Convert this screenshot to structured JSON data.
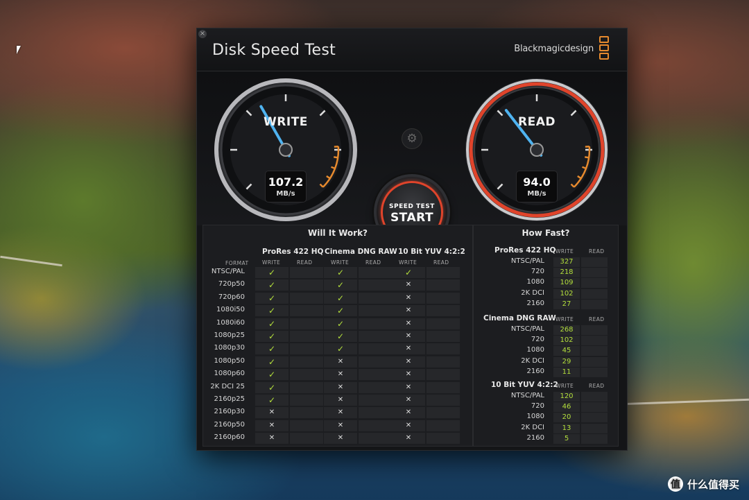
{
  "window": {
    "title": "Disk Speed Test",
    "brand": "Blackmagicdesign",
    "close_glyph": "×"
  },
  "gauges": {
    "write": {
      "label": "WRITE",
      "value": "107.2",
      "unit": "MB/s",
      "needle_level": 0.39
    },
    "read": {
      "label": "READ",
      "value": "94.0",
      "unit": "MB/s",
      "needle_level": 0.36
    }
  },
  "start_button": {
    "line1": "SPEED TEST",
    "line2": "START"
  },
  "settings_icon": "⚙",
  "will_it_work": {
    "title": "Will It Work?",
    "format_header": "FORMAT",
    "write_label": "WRITE",
    "read_label": "READ",
    "groups": [
      "ProRes 422 HQ",
      "Cinema DNG RAW",
      "10 Bit YUV 4:2:2"
    ],
    "rows": [
      {
        "format": "NTSC/PAL",
        "marks": [
          "ok",
          "",
          "ok",
          "",
          "ok",
          ""
        ]
      },
      {
        "format": "720p50",
        "marks": [
          "ok",
          "",
          "ok",
          "",
          "no",
          ""
        ]
      },
      {
        "format": "720p60",
        "marks": [
          "ok",
          "",
          "ok",
          "",
          "no",
          ""
        ]
      },
      {
        "format": "1080i50",
        "marks": [
          "ok",
          "",
          "ok",
          "",
          "no",
          ""
        ]
      },
      {
        "format": "1080i60",
        "marks": [
          "ok",
          "",
          "ok",
          "",
          "no",
          ""
        ]
      },
      {
        "format": "1080p25",
        "marks": [
          "ok",
          "",
          "ok",
          "",
          "no",
          ""
        ]
      },
      {
        "format": "1080p30",
        "marks": [
          "ok",
          "",
          "ok",
          "",
          "no",
          ""
        ]
      },
      {
        "format": "1080p50",
        "marks": [
          "ok",
          "",
          "no",
          "",
          "no",
          ""
        ]
      },
      {
        "format": "1080p60",
        "marks": [
          "ok",
          "",
          "no",
          "",
          "no",
          ""
        ]
      },
      {
        "format": "2K DCI 25",
        "marks": [
          "ok",
          "",
          "no",
          "",
          "no",
          ""
        ]
      },
      {
        "format": "2160p25",
        "marks": [
          "ok",
          "",
          "no",
          "",
          "no",
          ""
        ]
      },
      {
        "format": "2160p30",
        "marks": [
          "no",
          "",
          "no",
          "",
          "no",
          ""
        ]
      },
      {
        "format": "2160p50",
        "marks": [
          "no",
          "",
          "no",
          "",
          "no",
          ""
        ]
      },
      {
        "format": "2160p60",
        "marks": [
          "no",
          "",
          "no",
          "",
          "no",
          ""
        ]
      }
    ],
    "ok_glyph": "✓",
    "no_glyph": "✕"
  },
  "how_fast": {
    "title": "How Fast?",
    "write_label": "WRITE",
    "read_label": "READ",
    "sections": [
      {
        "name": "ProRes 422 HQ",
        "rows": [
          {
            "format": "NTSC/PAL",
            "write": "327",
            "read": ""
          },
          {
            "format": "720",
            "write": "218",
            "read": ""
          },
          {
            "format": "1080",
            "write": "109",
            "read": ""
          },
          {
            "format": "2K DCI",
            "write": "102",
            "read": ""
          },
          {
            "format": "2160",
            "write": "27",
            "read": ""
          }
        ]
      },
      {
        "name": "Cinema DNG RAW",
        "rows": [
          {
            "format": "NTSC/PAL",
            "write": "268",
            "read": ""
          },
          {
            "format": "720",
            "write": "102",
            "read": ""
          },
          {
            "format": "1080",
            "write": "45",
            "read": ""
          },
          {
            "format": "2K DCI",
            "write": "29",
            "read": ""
          },
          {
            "format": "2160",
            "write": "11",
            "read": ""
          }
        ]
      },
      {
        "name": "10 Bit YUV 4:2:2",
        "rows": [
          {
            "format": "NTSC/PAL",
            "write": "120",
            "read": ""
          },
          {
            "format": "720",
            "write": "46",
            "read": ""
          },
          {
            "format": "1080",
            "write": "20",
            "read": ""
          },
          {
            "format": "2K DCI",
            "write": "13",
            "read": ""
          },
          {
            "format": "2160",
            "write": "5",
            "read": ""
          }
        ]
      }
    ]
  },
  "watermark": {
    "icon": "值",
    "text": "什么值得买"
  },
  "colors": {
    "accent_orange": "#e68a2e",
    "ok_green": "#b4e03c",
    "needle_blue": "#4fb3f0",
    "read_ring": "#e0442b"
  }
}
